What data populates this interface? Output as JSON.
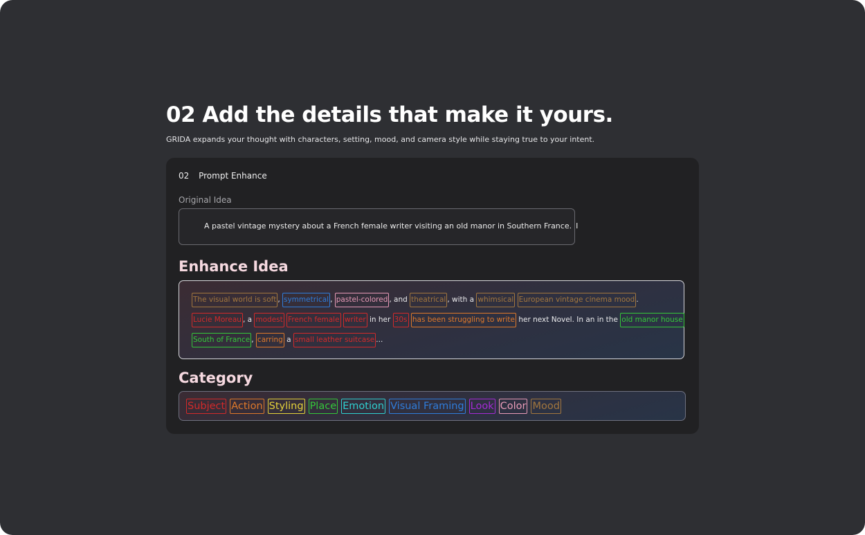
{
  "heading": "02 Add the details that make it yours.",
  "subheading": "GRIDA expands your thought with characters, setting, mood, and camera style while staying true to your intent.",
  "card": {
    "step_number": "02",
    "step_title": "Prompt Enhance",
    "original_label": "Original Idea",
    "original_text": "A pastel vintage mystery about a French female writer visiting an old manor in Southern France.",
    "caret": "I",
    "enhance_title": "Enhance Idea",
    "category_title": "Category"
  },
  "enhance_lines": [
    [
      {
        "text": "The visual world is soft",
        "cat": "mood"
      },
      {
        "text": ","
      },
      {
        "text": "symmetrical",
        "cat": "visual"
      },
      {
        "text": ","
      },
      {
        "text": "pastel-colored",
        "cat": "color"
      },
      {
        "text": ", and"
      },
      {
        "text": "theatrical",
        "cat": "mood"
      },
      {
        "text": ",  with a"
      },
      {
        "text": "whimsical",
        "cat": "mood"
      },
      {
        "text": "European vintage cinema mood",
        "cat": "mood"
      },
      {
        "text": "."
      }
    ],
    [
      {
        "text": "Lucie Moreau",
        "cat": "subject"
      },
      {
        "text": ", a"
      },
      {
        "text": "modest",
        "cat": "subject"
      },
      {
        "text": "French female",
        "cat": "subject"
      },
      {
        "text": "writer",
        "cat": "subject"
      },
      {
        "text": "in her"
      },
      {
        "text": "30s",
        "cat": "subject"
      },
      {
        "text": "has been struggling to write",
        "cat": "action"
      },
      {
        "text": "her next Novel. In an in the"
      },
      {
        "text": "old manor house",
        "cat": "place"
      }
    ],
    [
      {
        "text": "South of France",
        "cat": "place"
      },
      {
        "text": ","
      },
      {
        "text": "carring",
        "cat": "action"
      },
      {
        "text": "a"
      },
      {
        "text": "small leather suitcase",
        "cat": "subject"
      },
      {
        "text": "..."
      }
    ]
  ],
  "categories": [
    {
      "label": "Subject",
      "cat": "subject"
    },
    {
      "label": "Action",
      "cat": "action"
    },
    {
      "label": "Styling",
      "cat": "styling"
    },
    {
      "label": "Place",
      "cat": "place"
    },
    {
      "label": "Emotion",
      "cat": "emotion"
    },
    {
      "label": "Visual Framing",
      "cat": "visual"
    },
    {
      "label": "Look",
      "cat": "look"
    },
    {
      "label": "Color",
      "cat": "color"
    },
    {
      "label": "Mood",
      "cat": "mood"
    }
  ],
  "colors": {
    "background": "#2e2f33",
    "card": "#212123",
    "subject": "#d42a2a",
    "action": "#e0792a",
    "styling": "#e6d33a",
    "place": "#35c83a",
    "emotion": "#2fd1d1",
    "visual": "#2f7ddc",
    "look": "#a52ad6",
    "color": "#e99bb8",
    "mood": "#a3773e"
  }
}
